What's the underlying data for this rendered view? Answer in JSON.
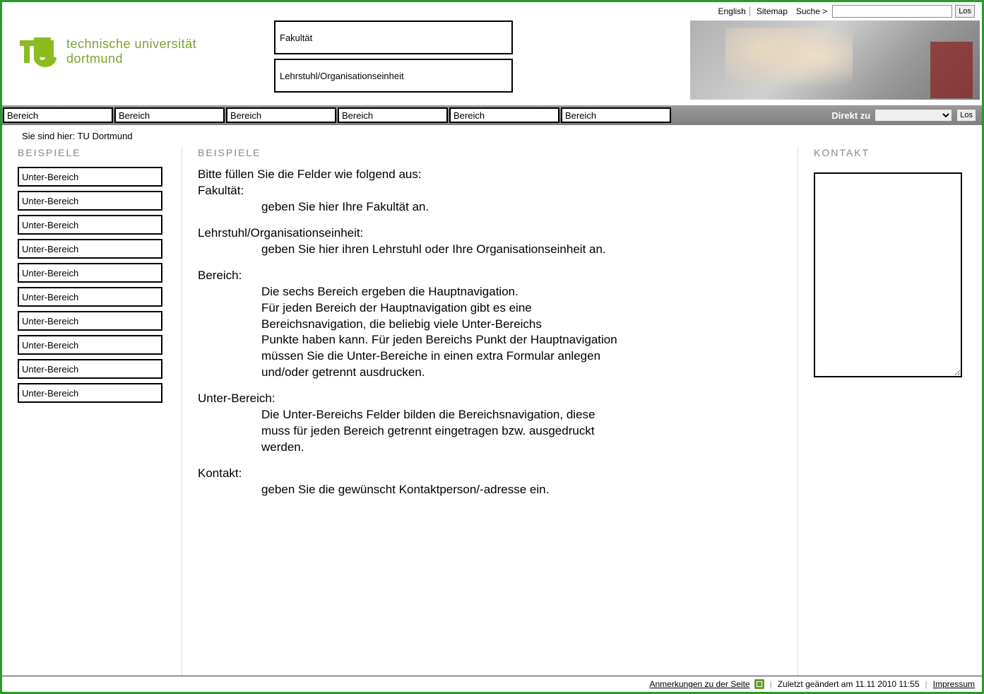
{
  "topbar": {
    "english": "English",
    "sitemap": "Sitemap",
    "search_label": "Suche >",
    "go": "Los"
  },
  "logo": {
    "line1": "technische universität",
    "line2": "dortmund"
  },
  "header": {
    "faculty_ph": "Fakultät",
    "chair_ph": "Lehrstuhl/Organisationseinheit"
  },
  "nav": {
    "areas": [
      "Bereich",
      "Bereich",
      "Bereich",
      "Bereich",
      "Bereich",
      "Bereich"
    ],
    "direkt_label": "Direkt zu",
    "go": "Los"
  },
  "breadcrumb": "Sie sind hier: TU Dortmund",
  "left": {
    "title": "BEISPIELE",
    "items": [
      "Unter-Bereich",
      "Unter-Bereich",
      "Unter-Bereich",
      "Unter-Bereich",
      "Unter-Bereich",
      "Unter-Bereich",
      "Unter-Bereich",
      "Unter-Bereich",
      "Unter-Bereich",
      "Unter-Bereich"
    ]
  },
  "main": {
    "title": "BEISPIELE",
    "intro": "Bitte füllen Sie die Felder wie folgend  aus:",
    "fak_label": "Fakultät:",
    "fak_text": "geben Sie hier Ihre Fakultät an.",
    "lehr_label": "Lehrstuhl/Organisationseinheit:",
    "lehr_text": "geben Sie hier ihren Lehrstuhl oder Ihre Organisationseinheit an.",
    "bereich_label": "Bereich:",
    "bereich_l1": "Die sechs Bereich ergeben die Hauptnavigation.",
    "bereich_l2": "Für jeden Bereich der Hauptnavigation gibt es eine",
    "bereich_l3": "Bereichsnavigation, die beliebig viele Unter-Bereichs",
    "bereich_l4": "Punkte haben kann. Für jeden Bereichs Punkt der Hauptnavigation",
    "bereich_l5": "müssen Sie die Unter-Bereiche in einen extra Formular anlegen",
    "bereich_l6": "und/oder getrennt ausdrucken.",
    "unter_label": "Unter-Bereich:",
    "unter_l1": "Die Unter-Bereichs Felder bilden die Bereichsnavigation, diese",
    "unter_l2": "muss für jeden Bereich getrennt eingetragen bzw. ausgedruckt",
    "unter_l3": "werden.",
    "kontakt_label": "Kontakt:",
    "kontakt_text": "geben Sie die gewünscht Kontaktperson/-adresse ein."
  },
  "right": {
    "title": "KONTAKT"
  },
  "footer": {
    "anmerkungen": "Anmerkungen zu der Seite",
    "changed": "Zuletzt geändert am 11.11 2010 11:55",
    "impressum": "Impressum"
  }
}
